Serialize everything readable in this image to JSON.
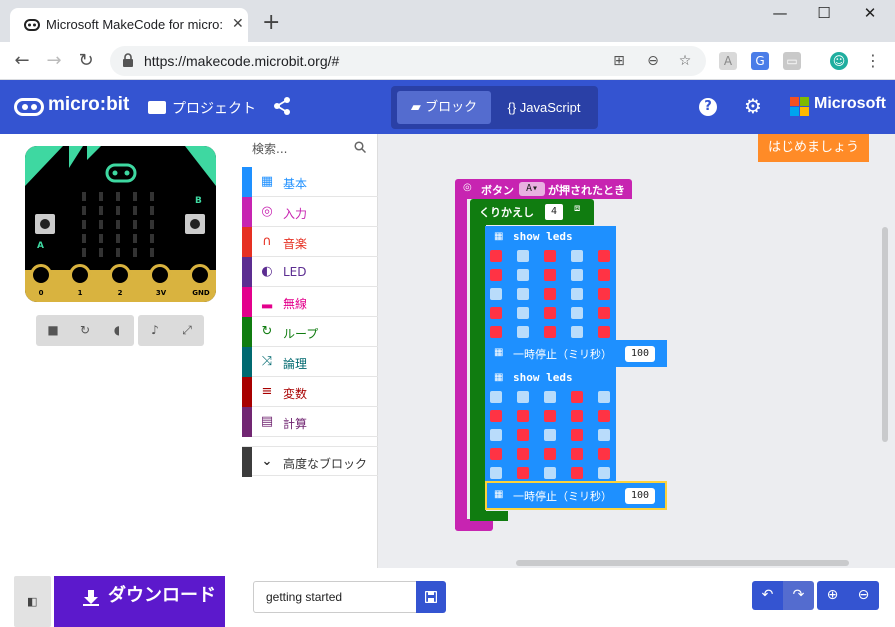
{
  "browser": {
    "tab_title": "Microsoft MakeCode for micro:bit",
    "url": "https://makecode.microbit.org/#"
  },
  "header": {
    "logo_text": "micro:bit",
    "projects_label": "プロジェクト",
    "blocks_label": "ブロック",
    "javascript_label": "JavaScript",
    "brand_text": "Microsoft"
  },
  "simulator": {
    "pin_labels": [
      "0",
      "1",
      "2",
      "3V",
      "GND"
    ],
    "button_a": "A",
    "button_b": "B"
  },
  "toolbox": {
    "search_placeholder": "検索...",
    "categories": [
      {
        "label": "基本",
        "color": "#1e90ff",
        "icon": "grid-icon"
      },
      {
        "label": "入力",
        "color": "#c724b1",
        "icon": "target-icon"
      },
      {
        "label": "音楽",
        "color": "#e63022",
        "icon": "headphones-icon"
      },
      {
        "label": "LED",
        "color": "#5c2d91",
        "icon": "toggle-icon"
      },
      {
        "label": "無線",
        "color": "#e3008c",
        "icon": "signal-icon"
      },
      {
        "label": "ループ",
        "color": "#107c10",
        "icon": "loop-icon"
      },
      {
        "label": "論理",
        "color": "#006970",
        "icon": "shuffle-icon"
      },
      {
        "label": "変数",
        "color": "#a80000",
        "icon": "list-icon"
      },
      {
        "label": "計算",
        "color": "#712672",
        "icon": "calculator-icon"
      }
    ],
    "advanced_label": "高度なブロック"
  },
  "workspace": {
    "getting_started_label": "はじめましょう",
    "event_block": {
      "prefix": "ボタン",
      "button_value": "A",
      "suffix": "が押されたとき",
      "color": "#c724b1"
    },
    "repeat_block": {
      "label": "くりかえし",
      "times": "4",
      "color": "#107c10"
    },
    "show_leds_label": "show leds",
    "pause_label": "一時停止（ミリ秒）",
    "pause_value_1": "100",
    "pause_value_2": "100",
    "basic_color": "#1e90ff",
    "led_on_color": "#ff3344",
    "led_off_color": "#b9dcfb",
    "pattern_1": [
      [
        1,
        0,
        1,
        0,
        1
      ],
      [
        1,
        0,
        1,
        0,
        1
      ],
      [
        0,
        0,
        1,
        0,
        1
      ],
      [
        1,
        0,
        1,
        0,
        1
      ],
      [
        1,
        0,
        1,
        0,
        1
      ]
    ],
    "pattern_2": [
      [
        0,
        0,
        0,
        1,
        0
      ],
      [
        1,
        1,
        1,
        1,
        1
      ],
      [
        0,
        1,
        0,
        1,
        0
      ],
      [
        1,
        1,
        1,
        1,
        1
      ],
      [
        0,
        1,
        0,
        1,
        0
      ]
    ]
  },
  "bottom": {
    "download_label": "ダウンロード",
    "project_name": "getting started"
  }
}
